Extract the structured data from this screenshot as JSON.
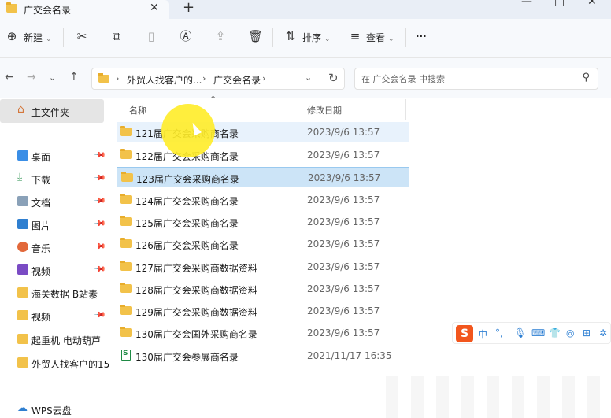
{
  "window": {
    "tab_title": "广交会名录",
    "tab_close": "✕",
    "tab_new": "+"
  },
  "toolbar": {
    "new_label": "新建",
    "sort_label": "排序",
    "view_label": "查看",
    "more": "···"
  },
  "nav": {
    "crumbs": [
      "外贸人找客户的...",
      "广交会名录"
    ],
    "search_placeholder": "在 广交会名录 中搜索"
  },
  "sidebar": {
    "home": "主文件夹",
    "items": [
      {
        "label": "桌面",
        "icon": "desktop-icon",
        "pinned": true
      },
      {
        "label": "下载",
        "icon": "download-icon",
        "pinned": true
      },
      {
        "label": "文档",
        "icon": "document-icon",
        "pinned": true
      },
      {
        "label": "图片",
        "icon": "picture-icon",
        "pinned": true
      },
      {
        "label": "音乐",
        "icon": "music-icon",
        "pinned": true
      },
      {
        "label": "视频",
        "icon": "video-icon",
        "pinned": true
      },
      {
        "label": "海关数据 B站素",
        "icon": "folder-icon",
        "pinned": false
      },
      {
        "label": "视频",
        "icon": "folder-icon",
        "pinned": true
      },
      {
        "label": "起重机 电动葫芦",
        "icon": "folder-icon",
        "pinned": false
      },
      {
        "label": "外贸人找客户的15",
        "icon": "folder-icon",
        "pinned": false
      },
      {
        "label": "WPS云盘",
        "icon": "cloud-icon",
        "pinned": false
      }
    ]
  },
  "columns": {
    "name": "名称",
    "date": "修改日期"
  },
  "files": [
    {
      "name": "121届广交会采购商名录",
      "date": "2023/9/6 13:57",
      "type": "folder"
    },
    {
      "name": "122届广交会采购商名录",
      "date": "2023/9/6 13:57",
      "type": "folder"
    },
    {
      "name": "123届广交会采购商名录",
      "date": "2023/9/6 13:57",
      "type": "folder"
    },
    {
      "name": "124届广交会采购商名录",
      "date": "2023/9/6 13:57",
      "type": "folder"
    },
    {
      "name": "125届广交会采购商名录",
      "date": "2023/9/6 13:57",
      "type": "folder"
    },
    {
      "name": "126届广交会采购商名录",
      "date": "2023/9/6 13:57",
      "type": "folder"
    },
    {
      "name": "127届广交会采购商数据资料",
      "date": "2023/9/6 13:57",
      "type": "folder"
    },
    {
      "name": "128届广交会采购商数据资料",
      "date": "2023/9/6 13:57",
      "type": "folder"
    },
    {
      "name": "129届广交会采购商数据资料",
      "date": "2023/9/6 13:57",
      "type": "folder"
    },
    {
      "name": "130届广交会国外采购商名录",
      "date": "2023/9/6 13:57",
      "type": "folder"
    },
    {
      "name": "130届广交会参展商名录",
      "date": "2021/11/17 16:35",
      "type": "spreadsheet"
    }
  ],
  "ime": {
    "logo": "S",
    "lang": "中",
    "punct": "°,"
  }
}
